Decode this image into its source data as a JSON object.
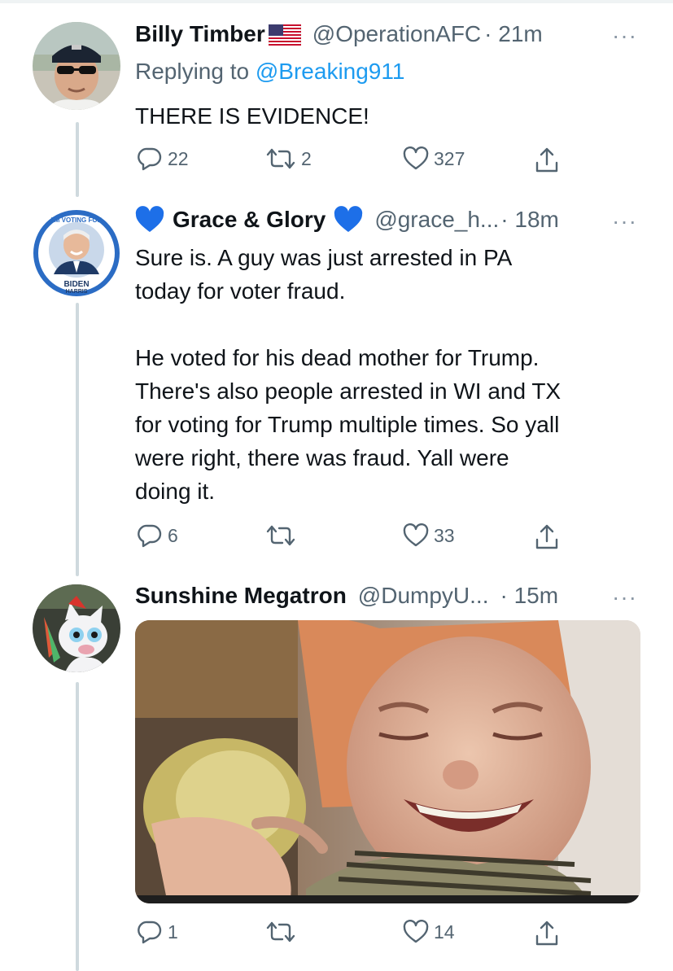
{
  "tweets": [
    {
      "name": "Billy Timber",
      "name_emoji": "us-flag",
      "handle": "@OperationAFC",
      "time": "· 21m",
      "reply_prefix": "Replying to",
      "reply_to": "@Breaking911",
      "body": [
        "THERE IS EVIDENCE!"
      ],
      "replies": "22",
      "retweets": "2",
      "likes": "327"
    },
    {
      "name": "Grace & Glory",
      "name_emoji": "blue-heart",
      "handle": "@grace_h...",
      "time": "· 18m",
      "avatar_badge_top": "I'M VOTING FOR",
      "avatar_badge_bottom1": "BIDEN",
      "avatar_badge_bottom2": "HARRIS",
      "body": [
        "Sure is.  A guy was just arrested in PA",
        "today for voter fraud.",
        "",
        "He voted for his dead mother for Trump.",
        "There's also people arrested in WI and TX",
        "for voting for Trump multiple times. So yall",
        "were right, there was fraud. Yall were",
        "doing it."
      ],
      "replies": "6",
      "retweets": "",
      "likes": "33"
    },
    {
      "name": "Sunshine Megatron",
      "handle": "@DumpyU...",
      "time": "· 15m",
      "media": "laughing-child-photo",
      "replies": "1",
      "retweets": "",
      "likes": "14"
    }
  ],
  "more_label": "···",
  "colors": {
    "text": "#0f1419",
    "secondary": "#536471",
    "link": "#1d9bf0",
    "thread_line": "#cfd9de",
    "heart_emoji": "#1d6fe8"
  },
  "icons": [
    "reply-icon",
    "retweet-icon",
    "like-icon",
    "share-icon",
    "more-icon"
  ]
}
